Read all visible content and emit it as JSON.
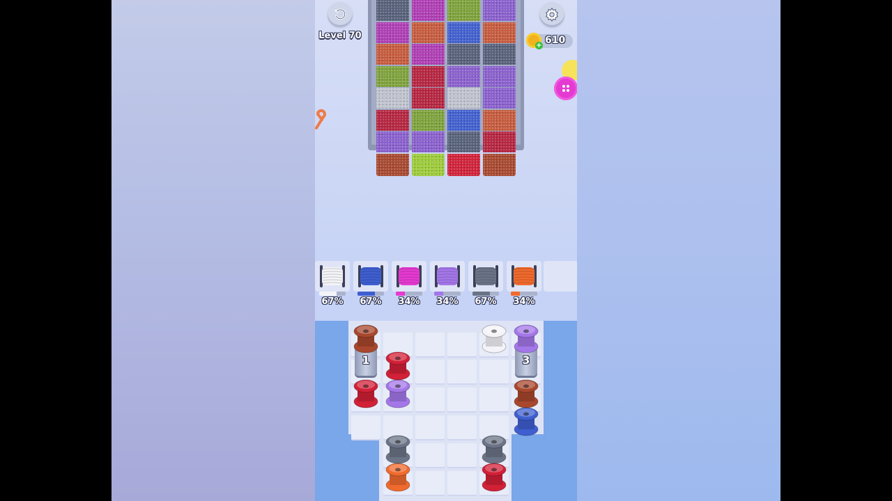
{
  "header": {
    "undo_icon": "undo-icon",
    "level_label": "Level 70",
    "settings_icon": "gear-icon",
    "coins": "610",
    "coin_icon": "coin-icon",
    "add_icon": "plus-icon"
  },
  "colors": {
    "slate": "#56607a",
    "magenta": "#b03cb5",
    "olive": "#7ea33a",
    "purple": "#8a5fcf",
    "rust": "#c85a3c",
    "blue": "#3f5fd0",
    "gray": "#67718a",
    "lime": "#9dcc38",
    "silver": "#c0c4cf",
    "crimson": "#b7233f",
    "red": "#d22037",
    "brown": "#a9472d",
    "white": "#f4f4f8",
    "pink": "#e53ad1",
    "lilac": "#a477e9",
    "orange": "#f06a2e",
    "darkgray": "#6b7487"
  },
  "cloth_columns": [
    [
      "slate",
      "magenta",
      "rust",
      "olive",
      "silver",
      "crimson",
      "purple",
      "brown"
    ],
    [
      "magenta",
      "rust",
      "magenta",
      "crimson",
      "crimson",
      "olive",
      "purple",
      "lime"
    ],
    [
      "olive",
      "blue",
      "slate",
      "purple",
      "silver",
      "blue",
      "slate",
      "red"
    ],
    [
      "purple",
      "rust",
      "slate",
      "purple",
      "purple",
      "rust",
      "crimson",
      "brown"
    ]
  ],
  "spool_tray": [
    {
      "name": "white",
      "color": "white",
      "progress": "67%",
      "fill": 0.67
    },
    {
      "name": "blue",
      "color": "blue",
      "progress": "67%",
      "fill": 0.67
    },
    {
      "name": "pink",
      "color": "pink",
      "progress": "34%",
      "fill": 0.34
    },
    {
      "name": "lilac",
      "color": "lilac",
      "progress": "34%",
      "fill": 0.34
    },
    {
      "name": "gray",
      "color": "darkgray",
      "progress": "67%",
      "fill": 0.67
    },
    {
      "name": "orange",
      "color": "orange",
      "progress": "34%",
      "fill": 0.34
    }
  ],
  "board_bobbins": [
    {
      "col": 0,
      "row": 0,
      "color": "brown"
    },
    {
      "col": 1,
      "row": 1,
      "color": "red"
    },
    {
      "col": 0,
      "row": 2,
      "color": "red"
    },
    {
      "col": 1,
      "row": 2,
      "color": "lilac"
    },
    {
      "col": 4,
      "row": 0,
      "color": "white"
    },
    {
      "col": 5,
      "row": 0,
      "color": "lilac"
    },
    {
      "col": 5,
      "row": 2,
      "color": "brown"
    },
    {
      "col": 5,
      "row": 3,
      "color": "blue"
    },
    {
      "col": 1,
      "row": 4,
      "color": "darkgray"
    },
    {
      "col": 1,
      "row": 5,
      "color": "orange"
    },
    {
      "col": 4,
      "row": 4,
      "color": "darkgray"
    },
    {
      "col": 4,
      "row": 5,
      "color": "red"
    }
  ],
  "pillars": [
    {
      "label": "1",
      "col": 0
    },
    {
      "label": "3",
      "col": 5
    }
  ]
}
